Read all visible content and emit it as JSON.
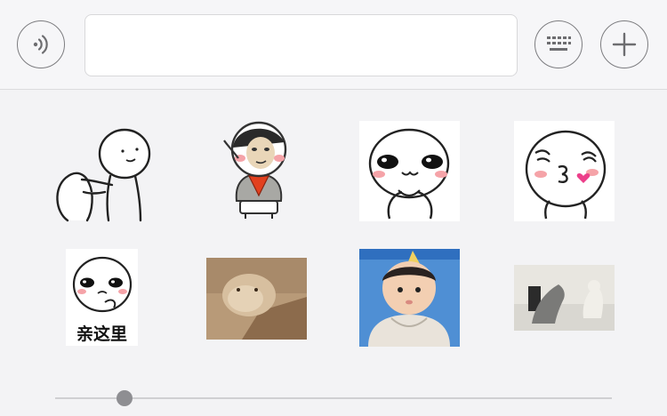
{
  "input_bar": {
    "voice_button": {
      "icon": "voice-wave-icon"
    },
    "message_input": {
      "value": "",
      "placeholder": ""
    },
    "keyboard_button": {
      "icon": "keyboard-icon"
    },
    "more_button": {
      "icon": "plus-icon"
    }
  },
  "sticker_panel": {
    "stickers": [
      {
        "icon": "sticker-stickman-hug"
      },
      {
        "icon": "sticker-saluting-face"
      },
      {
        "icon": "sticker-shy-face"
      },
      {
        "icon": "sticker-kiss-face"
      },
      {
        "icon": "sticker-text-face",
        "caption": "亲这里"
      },
      {
        "icon": "sticker-hamster-photo"
      },
      {
        "icon": "sticker-baby-photo"
      },
      {
        "icon": "sticker-cats-photo"
      }
    ],
    "page_slider": {
      "fraction": 0.11
    }
  },
  "colors": {
    "bar_background": "#f6f6f8",
    "panel_background": "#f3f3f5",
    "icon_stroke": "#7d7d80",
    "slider_thumb": "#8e8e92"
  }
}
